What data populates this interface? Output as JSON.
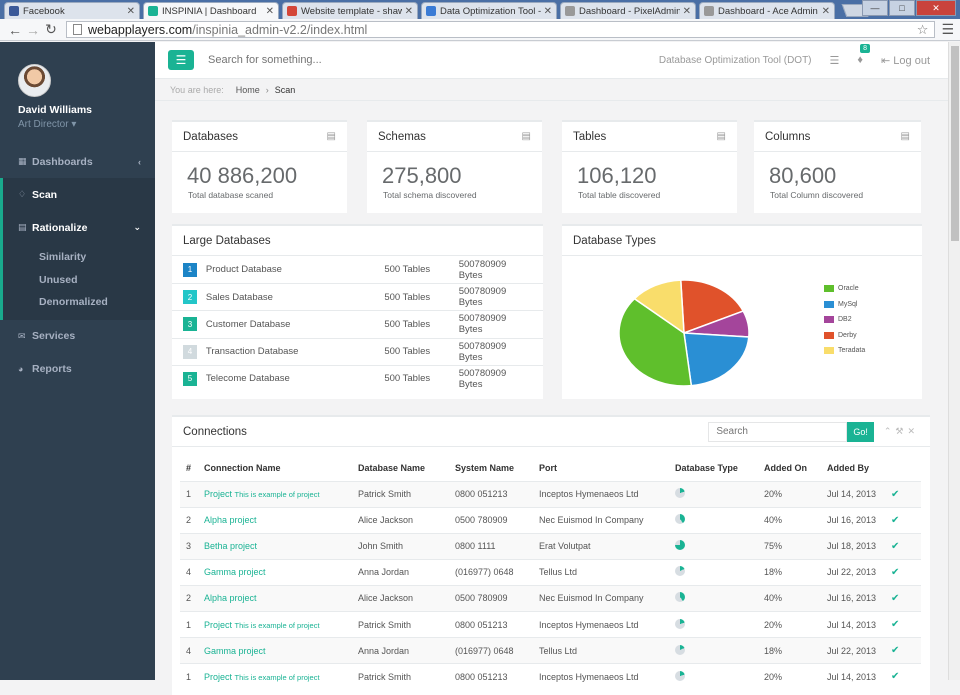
{
  "browser": {
    "tabs": [
      {
        "title": "Facebook",
        "color": "#3b5998"
      },
      {
        "title": "INSPINIA | Dashboard",
        "color": "#1ab394"
      },
      {
        "title": "Website template - shaw",
        "color": "#d44638"
      },
      {
        "title": "Data Optimization Tool - ",
        "color": "#3a7bd5"
      },
      {
        "title": "Dashboard - PixelAdmin",
        "color": "#999999"
      },
      {
        "title": "Dashboard - Ace Admin",
        "color": "#999999"
      }
    ],
    "url_host": "webapplayers.com",
    "url_path": "/inspinia_admin-v2.2/index.html"
  },
  "profile": {
    "name": "David Williams",
    "role": "Art Director"
  },
  "nav": {
    "dashboards": "Dashboards",
    "scan": "Scan",
    "rationalize": "Rationalize",
    "sub": [
      "Similarity",
      "Unused",
      "Denormalized"
    ],
    "services": "Services",
    "reports": "Reports"
  },
  "topbar": {
    "search_placeholder": "Search for something...",
    "app_name": "Database Optimization Tool (DOT)",
    "badge": "8",
    "logout": "Log out"
  },
  "breadcrumb": {
    "prefix": "You are here:",
    "home": "Home",
    "current": "Scan"
  },
  "stats": [
    {
      "title": "Databases",
      "value": "40 886,200",
      "label": "Total database scaned"
    },
    {
      "title": "Schemas",
      "value": "275,800",
      "label": "Total schema discovered"
    },
    {
      "title": "Tables",
      "value": "106,120",
      "label": "Total table discovered"
    },
    {
      "title": "Columns",
      "value": "80,600",
      "label": "Total Column discovered"
    }
  ],
  "large_databases": {
    "title": "Large Databases",
    "rows": [
      {
        "n": "1",
        "color": "#1c84c6",
        "name": "Product Database",
        "tables": "500 Tables",
        "bytes": "500780909 Bytes"
      },
      {
        "n": "2",
        "color": "#23c6c8",
        "name": "Sales Database",
        "tables": "500 Tables",
        "bytes": "500780909 Bytes"
      },
      {
        "n": "3",
        "color": "#1ab394",
        "name": "Customer Database",
        "tables": "500 Tables",
        "bytes": "500780909 Bytes"
      },
      {
        "n": "4",
        "color": "#d1dade",
        "name": "Transaction Database",
        "tables": "500 Tables",
        "bytes": "500780909 Bytes"
      },
      {
        "n": "5",
        "color": "#1ab394",
        "name": "Telecome Database",
        "tables": "500 Tables",
        "bytes": "500780909 Bytes"
      }
    ]
  },
  "chart_data": {
    "type": "pie",
    "title": "Database Types",
    "slices": [
      {
        "label": "Oracle",
        "value": 38,
        "color": "#5fbf2c"
      },
      {
        "label": "MySql",
        "value": 22,
        "color": "#2a8fd4"
      },
      {
        "label": "DB2",
        "value": 8,
        "color": "#a4459b"
      },
      {
        "label": "Derby",
        "value": 19,
        "color": "#e0522b"
      },
      {
        "label": "Teradata",
        "value": 13,
        "color": "#f9dd6b"
      }
    ],
    "slice_order": [
      "Derby",
      "DB2",
      "MySql",
      "Oracle",
      "Teradata"
    ],
    "legend_position": "right"
  },
  "connections": {
    "title": "Connections",
    "search_placeholder": "Search",
    "go": "Go!",
    "headers": [
      "#",
      "Connection Name",
      "Database Name",
      "System Name",
      "Port",
      "Database Type",
      "Added On",
      "Added By"
    ],
    "rows": [
      {
        "n": "1",
        "name": "Project",
        "note": "This is example of project",
        "db": "Patrick Smith",
        "sys": "0800 051213",
        "port": "Inceptos Hymenaeos Ltd",
        "pct": 0.2,
        "added_on": "20%",
        "by": "Jul 14, 2013"
      },
      {
        "n": "2",
        "name": "Alpha project",
        "note": "",
        "db": "Alice Jackson",
        "sys": "0500 780909",
        "port": "Nec Euismod In Company",
        "pct": 0.4,
        "added_on": "40%",
        "by": "Jul 16, 2013"
      },
      {
        "n": "3",
        "name": "Betha project",
        "note": "",
        "db": "John Smith",
        "sys": "0800 1111",
        "port": "Erat Volutpat",
        "pct": 0.75,
        "added_on": "75%",
        "by": "Jul 18, 2013"
      },
      {
        "n": "4",
        "name": "Gamma project",
        "note": "",
        "db": "Anna Jordan",
        "sys": "(016977) 0648",
        "port": "Tellus Ltd",
        "pct": 0.18,
        "added_on": "18%",
        "by": "Jul 22, 2013"
      },
      {
        "n": "2",
        "name": "Alpha project",
        "note": "",
        "db": "Alice Jackson",
        "sys": "0500 780909",
        "port": "Nec Euismod In Company",
        "pct": 0.4,
        "added_on": "40%",
        "by": "Jul 16, 2013"
      },
      {
        "n": "1",
        "name": "Project",
        "note": "This is example of project",
        "db": "Patrick Smith",
        "sys": "0800 051213",
        "port": "Inceptos Hymenaeos Ltd",
        "pct": 0.2,
        "added_on": "20%",
        "by": "Jul 14, 2013"
      },
      {
        "n": "4",
        "name": "Gamma project",
        "note": "",
        "db": "Anna Jordan",
        "sys": "(016977) 0648",
        "port": "Tellus Ltd",
        "pct": 0.18,
        "added_on": "18%",
        "by": "Jul 22, 2013"
      },
      {
        "n": "1",
        "name": "Project",
        "note": "This is example of project",
        "db": "Patrick Smith",
        "sys": "0800 051213",
        "port": "Inceptos Hymenaeos Ltd",
        "pct": 0.2,
        "added_on": "20%",
        "by": "Jul 14, 2013"
      }
    ]
  }
}
